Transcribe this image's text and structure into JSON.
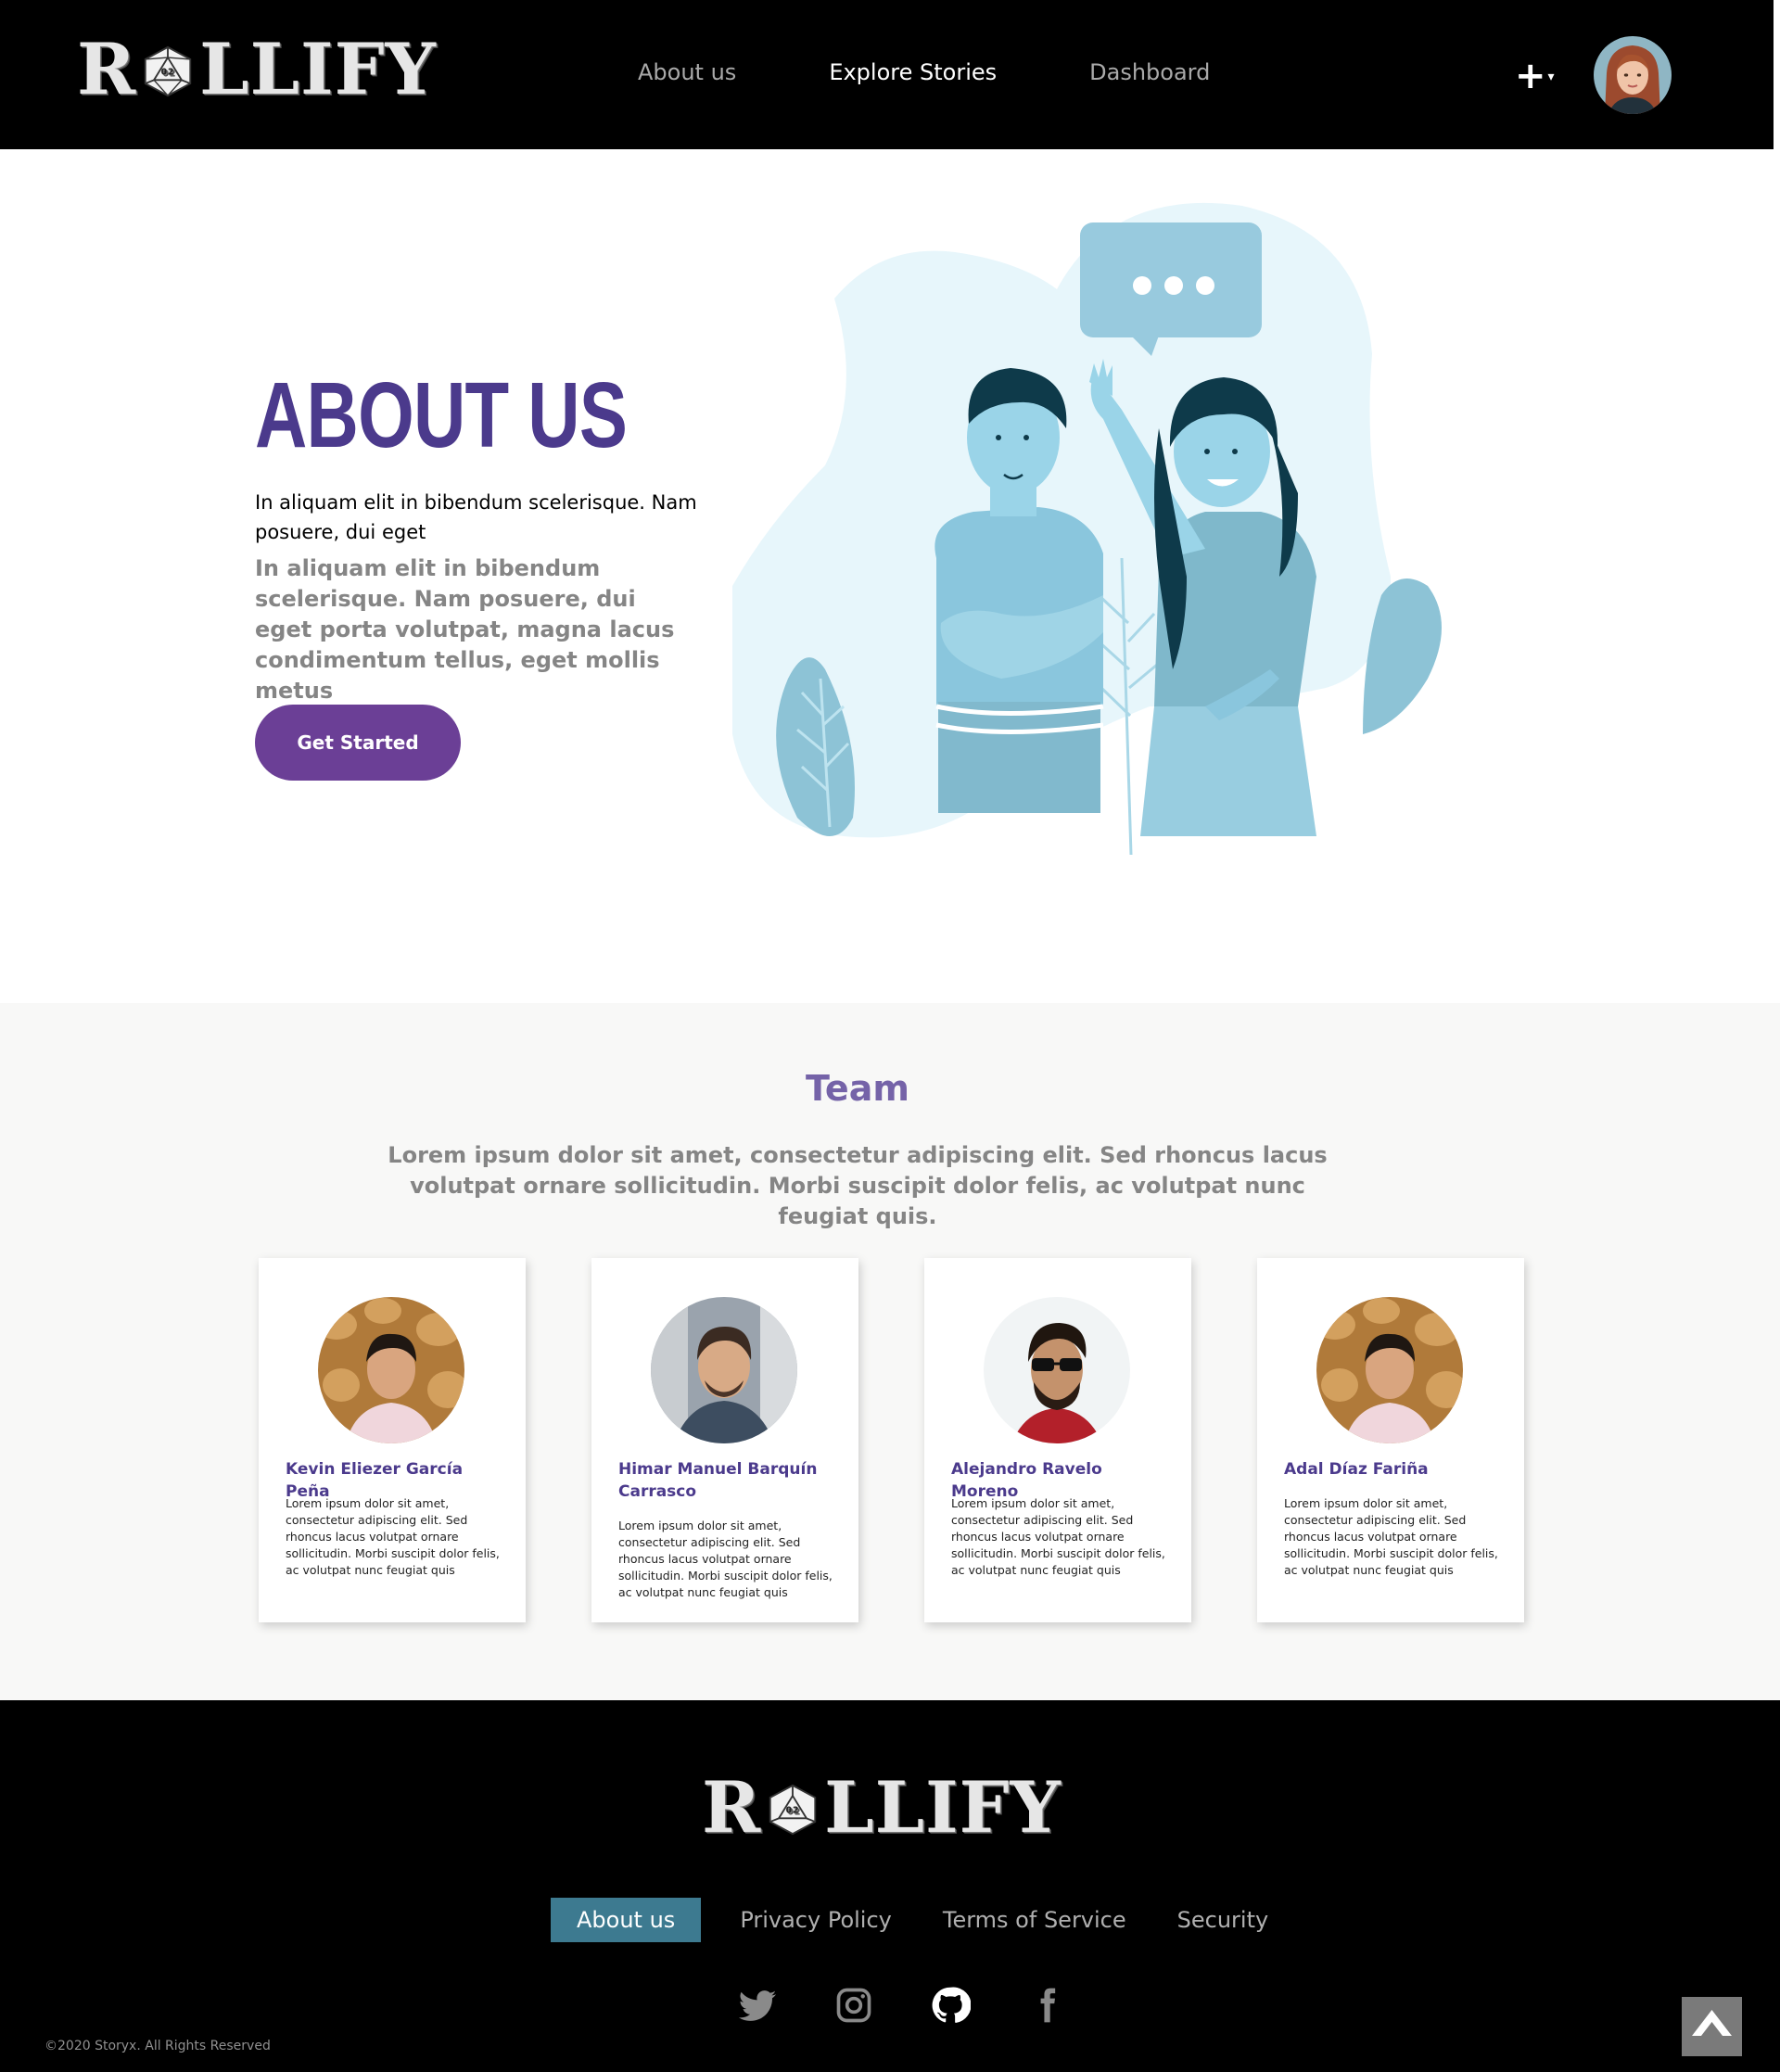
{
  "header": {
    "logo_text": "ROLLIFY",
    "nav": [
      {
        "label": "About us"
      },
      {
        "label": "Explore Stories"
      },
      {
        "label": "Dashboard"
      }
    ],
    "create_label": "+",
    "create_caret": "▾"
  },
  "hero": {
    "title": "ABOUT US",
    "lead": "In aliquam elit in bibendum scelerisque. Nam posuere, dui eget",
    "body": "In aliquam elit in bibendum scelerisque. Nam posuere, dui eget porta volutpat, magna lacus condimentum tellus, eget mollis metus",
    "cta_label": "Get Started"
  },
  "team": {
    "title": "Team",
    "subtitle": "Lorem ipsum dolor sit amet, consectetur adipiscing elit. Sed rhoncus lacus volutpat ornare sollicitudin. Morbi suscipit dolor felis, ac volutpat nunc feugiat quis.",
    "members": [
      {
        "name": "Kevin Eliezer García Peña",
        "bio": "Lorem ipsum dolor sit amet, consectetur adipiscing elit. Sed rhoncus lacus volutpat ornare sollicitudin. Morbi suscipit dolor felis, ac volutpat nunc feugiat quis"
      },
      {
        "name": "Himar Manuel Barquín Carrasco",
        "bio": "Lorem ipsum dolor sit amet, consectetur adipiscing elit. Sed rhoncus lacus volutpat ornare sollicitudin. Morbi suscipit dolor felis, ac volutpat nunc feugiat quis"
      },
      {
        "name": "Alejandro Ravelo Moreno",
        "bio": "Lorem ipsum dolor sit amet, consectetur adipiscing elit. Sed rhoncus lacus volutpat ornare sollicitudin. Morbi suscipit dolor felis, ac volutpat nunc feugiat quis"
      },
      {
        "name": "Adal Díaz Fariña",
        "bio": "Lorem ipsum dolor sit amet, consectetur adipiscing elit. Sed rhoncus lacus volutpat ornare sollicitudin. Morbi suscipit dolor felis, ac volutpat nunc feugiat quis"
      }
    ]
  },
  "footer": {
    "logo_text": "ROLLIFY",
    "links": [
      {
        "label": "About us"
      },
      {
        "label": "Privacy Policy"
      },
      {
        "label": "Terms of Service"
      },
      {
        "label": "Security"
      }
    ],
    "social_icons": [
      "twitter-icon",
      "instagram-icon",
      "github-icon",
      "facebook-icon"
    ],
    "copyright": "©2020 Storyx. All Rights Reserved"
  },
  "colors": {
    "brand_purple": "#4b3a8c",
    "button_purple": "#6b3f96",
    "footer_active": "#3d7a90",
    "illustration_blue": "#8fc9dd"
  }
}
